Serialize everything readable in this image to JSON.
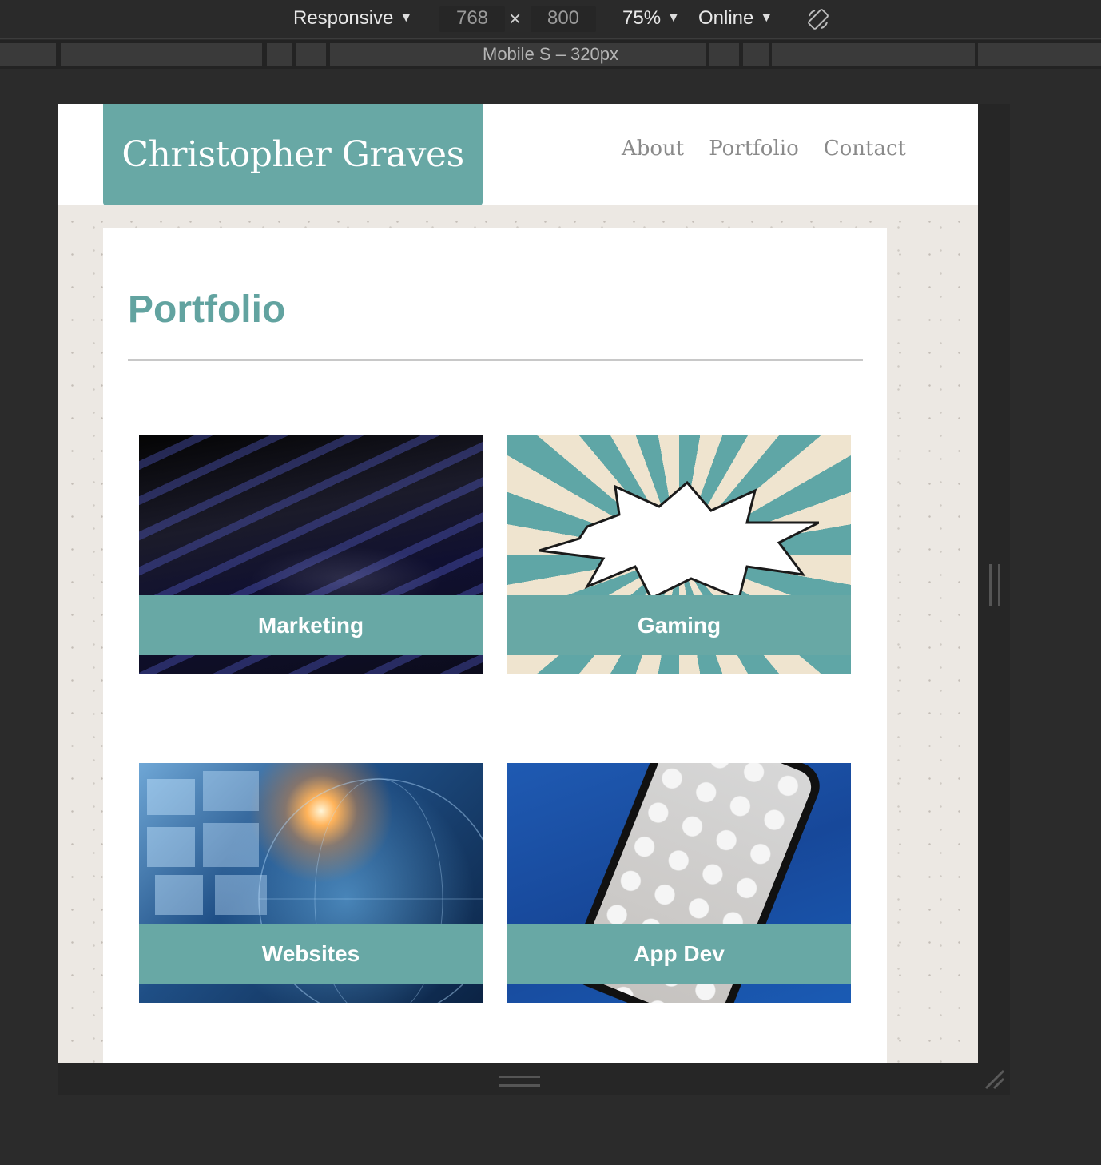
{
  "devtools": {
    "device_label": "Responsive",
    "width_value": "768",
    "times_symbol": "×",
    "height_value": "800",
    "zoom_label": "75%",
    "network_label": "Online",
    "preset_label": "Mobile S – 320px"
  },
  "site": {
    "brand": "Christopher Graves",
    "nav": [
      "About",
      "Portfolio",
      "Contact"
    ],
    "page_title": "Portfolio",
    "tiles": [
      {
        "caption": "Marketing",
        "image": "keyboard-photo"
      },
      {
        "caption": "Gaming",
        "image": "comic-burst-illustration"
      },
      {
        "caption": "Websites",
        "image": "digital-globe-photo"
      },
      {
        "caption": "App Dev",
        "image": "smartphone-photo"
      }
    ]
  },
  "colors": {
    "accent": "#68a8a5",
    "title": "#62a3a0",
    "nav_text": "#8a8a8a",
    "devtools_bg": "#2a2a2a"
  },
  "icons": {
    "rotate": "rotate-device-icon",
    "caret": "caret-down-icon"
  }
}
